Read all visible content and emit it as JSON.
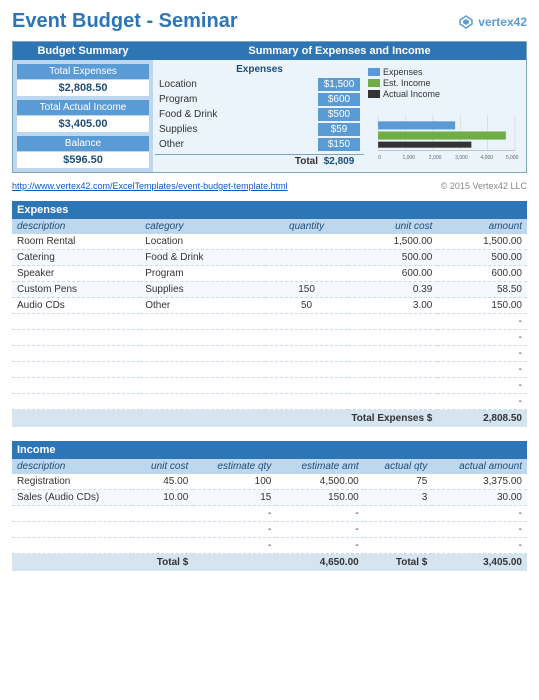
{
  "header": {
    "title": "Event Budget - Seminar",
    "logo_text": "vertex42"
  },
  "budget_summary": {
    "header": "Budget Summary",
    "rows": [
      {
        "label": "Total Expenses",
        "value": "$2,808.50"
      },
      {
        "label": "Total Actual Income",
        "value": "$3,405.00"
      },
      {
        "label": "Balance",
        "value": "$596.50"
      }
    ]
  },
  "expenses_income_summary": {
    "header": "Summary of Expenses and Income",
    "expenses_sub_header": "Expenses",
    "expense_rows": [
      {
        "label": "Location",
        "value": "$1,500"
      },
      {
        "label": "Program",
        "value": "$600"
      },
      {
        "label": "Food & Drink",
        "value": "$500"
      },
      {
        "label": "Supplies",
        "value": "$59"
      },
      {
        "label": "Other",
        "value": "$150"
      }
    ],
    "total_label": "Total",
    "total_value": "$2,809",
    "chart": {
      "legend": [
        {
          "label": "Expenses",
          "color": "#5B9BD5"
        },
        {
          "label": "Est. Income",
          "color": "#70AD47"
        },
        {
          "label": "Actual Income",
          "color": "#333333"
        }
      ],
      "x_labels": [
        "0",
        "1,000",
        "2,000",
        "3,000",
        "4,000",
        "5,000"
      ],
      "bars": [
        {
          "name": "Expenses",
          "value": 2809,
          "color": "#5B9BD5",
          "max": 5000
        },
        {
          "name": "Est. Income",
          "value": 4650,
          "color": "#70AD47",
          "max": 5000
        },
        {
          "name": "Actual Income",
          "value": 3405,
          "color": "#1F1F1F",
          "max": 5000
        }
      ]
    }
  },
  "url": "http://www.vertex42.com/ExcelTemplates/event-budget-template.html",
  "copyright": "© 2015 Vertex42 LLC",
  "expenses_table": {
    "section_header": "Expenses",
    "columns": [
      "description",
      "category",
      "quantity",
      "unit cost",
      "amount"
    ],
    "rows": [
      {
        "description": "Room Rental",
        "category": "Location",
        "quantity": "",
        "unit_cost": "1,500.00",
        "amount": "1,500.00"
      },
      {
        "description": "Catering",
        "category": "Food & Drink",
        "quantity": "",
        "unit_cost": "500.00",
        "amount": "500.00"
      },
      {
        "description": "Speaker",
        "category": "Program",
        "quantity": "",
        "unit_cost": "600.00",
        "amount": "600.00"
      },
      {
        "description": "Custom Pens",
        "category": "Supplies",
        "quantity": "150",
        "unit_cost": "0.39",
        "amount": "58.50"
      },
      {
        "description": "Audio CDs",
        "category": "Other",
        "quantity": "50",
        "unit_cost": "3.00",
        "amount": "150.00"
      }
    ],
    "empty_rows": 6,
    "total_label": "Total Expenses $",
    "total_value": "2,808.50"
  },
  "income_table": {
    "section_header": "Income",
    "columns": [
      "description",
      "unit cost",
      "estimate qty",
      "estimate amt",
      "actual qty",
      "actual amount"
    ],
    "rows": [
      {
        "description": "Registration",
        "unit_cost": "45.00",
        "est_qty": "100",
        "est_amt": "4,500.00",
        "act_qty": "75",
        "act_amount": "3,375.00"
      },
      {
        "description": "Sales (Audio CDs)",
        "unit_cost": "10.00",
        "est_qty": "15",
        "est_amt": "150.00",
        "act_qty": "3",
        "act_amount": "30.00"
      }
    ],
    "empty_rows": 3,
    "total_label": "Total $",
    "est_total": "4,650.00",
    "act_total_label": "Total $",
    "act_total": "3,405.00"
  }
}
